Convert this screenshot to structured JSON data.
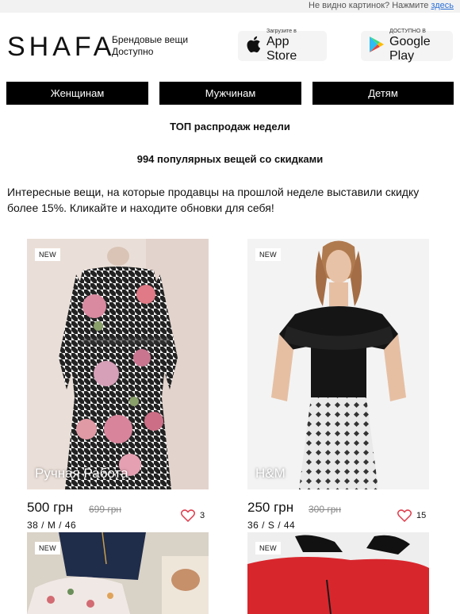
{
  "topbar": {
    "text": "Не видно картинок? Нажмите",
    "link": "здесь"
  },
  "header": {
    "logo": "SHAFA",
    "tagline_line1": "Брендовые вещи",
    "tagline_line2": "Доступно",
    "appstore": {
      "small": "Загрузите в",
      "big": "App Store"
    },
    "googleplay": {
      "small": "ДОСТУПНО В",
      "big": "Google Play"
    }
  },
  "nav": {
    "women": "Женщинам",
    "men": "Мужчинам",
    "kids": "Детям"
  },
  "main": {
    "title": "ТОП распродаж недели",
    "subtitle": "994 популярных вещей со скидками",
    "intro": "Интересные вещи, на которые продавцы на прошлой неделе выставили скидку более 15%. Кликайте и находите обновки для себя!"
  },
  "products": [
    {
      "badge": "NEW",
      "brand": "Ручная Работа",
      "price": "500 грн",
      "old_price": "699 грн",
      "sizes": "38 / M / 46",
      "likes": "3"
    },
    {
      "badge": "NEW",
      "brand": "H&M",
      "price": "250 грн",
      "old_price": "300 грн",
      "sizes": "36 / S / 44",
      "likes": "15"
    },
    {
      "badge": "NEW"
    },
    {
      "badge": "NEW"
    }
  ],
  "colors": {
    "nav_bg": "#000000",
    "nav_text": "#ffffff",
    "link": "#2a6fd6"
  }
}
